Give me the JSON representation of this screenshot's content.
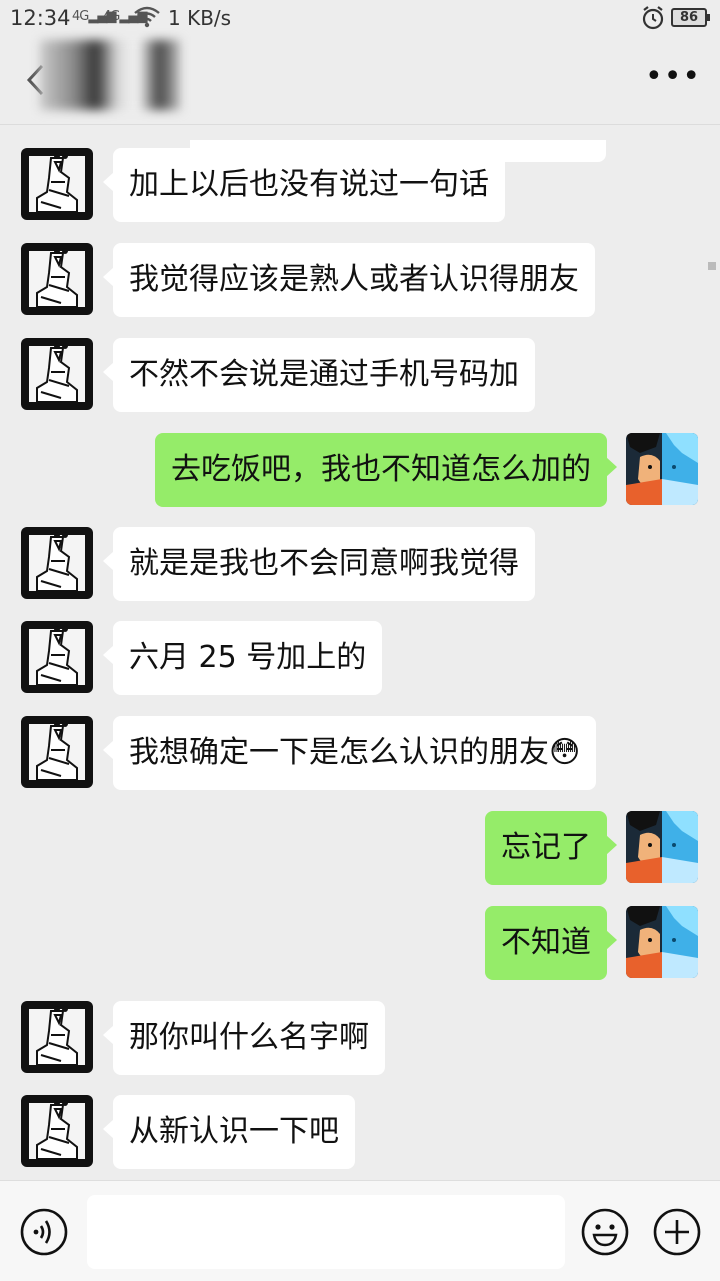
{
  "status_bar": {
    "time": "12:34",
    "signal1": "4G",
    "signal2": "4G",
    "speed": "1 KB/s",
    "battery": "86"
  },
  "nav": {
    "title": "",
    "more_icon": "more-dots-icon",
    "back_icon": "chevron-left-icon"
  },
  "messages": [
    {
      "side": "in",
      "text": "加上以后也没有说过一句话"
    },
    {
      "side": "in",
      "text": "我觉得应该是熟人或者认识得朋友"
    },
    {
      "side": "in",
      "text": "不然不会说是通过手机号码加"
    },
    {
      "side": "out",
      "text": "去吃饭吧，我也不知道怎么加的"
    },
    {
      "side": "in",
      "text": "就是是我也不会同意啊我觉得"
    },
    {
      "side": "in",
      "text": "六月 25 号加上的"
    },
    {
      "side": "in",
      "text": "我想确定一下是怎么认识的朋友😳"
    },
    {
      "side": "out",
      "text": "忘记了"
    },
    {
      "side": "out",
      "text": "不知道"
    },
    {
      "side": "in",
      "text": "那你叫什么名字啊"
    },
    {
      "side": "in",
      "text": "从新认识一下吧"
    }
  ],
  "input_bar": {
    "placeholder": "",
    "voice_icon": "voice-icon",
    "emoji_icon": "emoji-icon",
    "plus_icon": "plus-icon"
  },
  "colors": {
    "background": "#ededed",
    "incoming_bubble": "#ffffff",
    "outgoing_bubble": "#95ec69"
  }
}
